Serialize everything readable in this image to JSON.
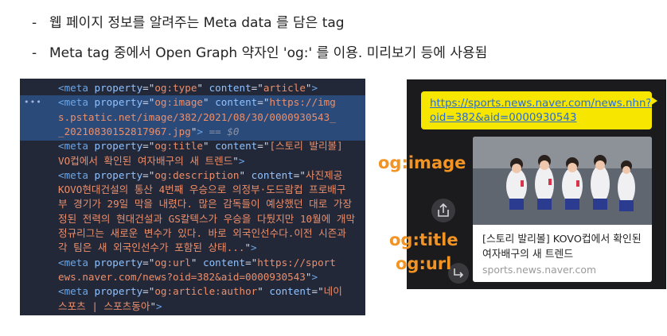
{
  "bullets": [
    {
      "dash": "-",
      "text": "웹 페이지 정보를 알려주는 Meta data 를 담은 tag"
    },
    {
      "dash": "-",
      "text": "Meta tag 중에서 Open Graph 약자인 'og:' 를 이용. 미리보기 등에 사용됨"
    }
  ],
  "code": {
    "gutter_marker": "•••",
    "lines": [
      [
        {
          "c": "tag",
          "t": "<meta "
        },
        {
          "c": "attr",
          "t": "property"
        },
        {
          "c": "eq",
          "t": "=\""
        },
        {
          "c": "str",
          "t": "og:type"
        },
        {
          "c": "eq",
          "t": "\" "
        },
        {
          "c": "attr",
          "t": "content"
        },
        {
          "c": "eq",
          "t": "=\""
        },
        {
          "c": "str",
          "t": "article"
        },
        {
          "c": "eq",
          "t": "\""
        },
        {
          "c": "tag",
          "t": ">"
        }
      ],
      [
        {
          "c": "tag",
          "t": "<meta "
        },
        {
          "c": "attr",
          "t": "property"
        },
        {
          "c": "eq",
          "t": "=\""
        },
        {
          "c": "str",
          "t": "og:image"
        },
        {
          "c": "eq",
          "t": "\" "
        },
        {
          "c": "attr",
          "t": "content"
        },
        {
          "c": "eq",
          "t": "=\""
        },
        {
          "c": "str",
          "t": "https://img"
        }
      ],
      [
        {
          "c": "str",
          "t": "s.pstatic.net/image/382/2021/08/30/0000930543_"
        }
      ],
      [
        {
          "c": "str",
          "t": "_20210830152817967.jpg"
        },
        {
          "c": "eq",
          "t": "\""
        },
        {
          "c": "tag",
          "t": ">"
        },
        {
          "c": "dim",
          "t": " == $0"
        }
      ],
      [
        {
          "c": "tag",
          "t": "<meta "
        },
        {
          "c": "attr",
          "t": "property"
        },
        {
          "c": "eq",
          "t": "=\""
        },
        {
          "c": "str",
          "t": "og:title"
        },
        {
          "c": "eq",
          "t": "\" "
        },
        {
          "c": "attr",
          "t": "content"
        },
        {
          "c": "eq",
          "t": "=\""
        },
        {
          "c": "str",
          "t": "[스토리 발리볼]"
        }
      ],
      [
        {
          "c": "str",
          "t": "VO컵에서 확인된 여자배구의 새 트렌드"
        },
        {
          "c": "eq",
          "t": "\""
        },
        {
          "c": "tag",
          "t": ">"
        }
      ],
      [
        {
          "c": "tag",
          "t": "<meta "
        },
        {
          "c": "attr",
          "t": "property"
        },
        {
          "c": "eq",
          "t": "=\""
        },
        {
          "c": "str",
          "t": "og:description"
        },
        {
          "c": "eq",
          "t": "\" "
        },
        {
          "c": "attr",
          "t": "content"
        },
        {
          "c": "eq",
          "t": "=\""
        },
        {
          "c": "str",
          "t": "사진제공"
        }
      ],
      [
        {
          "c": "str",
          "t": "KOVO현대건설의 통산 4번째 우승으로 의정부·도드람컵 프로배구"
        }
      ],
      [
        {
          "c": "str",
          "t": "부 경기가 29일 막을 내렸다. 많은 감독들이 예상했던 대로 가장"
        }
      ],
      [
        {
          "c": "str",
          "t": "정된 전력의 현대건설과 GS칼텍스가 우승을 다퉜지만 10월에 개막"
        }
      ],
      [
        {
          "c": "str",
          "t": "정규리그는 새로운 변수가 있다. 바로 외국인선수다.이전 시즌과"
        }
      ],
      [
        {
          "c": "str",
          "t": "각 팀은 새 외국인선수가 포함된 상태..."
        },
        {
          "c": "eq",
          "t": "\""
        },
        {
          "c": "tag",
          "t": ">"
        }
      ],
      [
        {
          "c": "tag",
          "t": "<meta "
        },
        {
          "c": "attr",
          "t": "property"
        },
        {
          "c": "eq",
          "t": "=\""
        },
        {
          "c": "str",
          "t": "og:url"
        },
        {
          "c": "eq",
          "t": "\" "
        },
        {
          "c": "attr",
          "t": "content"
        },
        {
          "c": "eq",
          "t": "=\""
        },
        {
          "c": "str",
          "t": "https://sport"
        }
      ],
      [
        {
          "c": "str",
          "t": "ews.naver.com/news?oid=382&aid=0000930543"
        },
        {
          "c": "eq",
          "t": "\""
        },
        {
          "c": "tag",
          "t": ">"
        }
      ],
      [
        {
          "c": "tag",
          "t": "<meta "
        },
        {
          "c": "attr",
          "t": "property"
        },
        {
          "c": "eq",
          "t": "=\""
        },
        {
          "c": "str",
          "t": "og:article:author"
        },
        {
          "c": "eq",
          "t": "\" "
        },
        {
          "c": "attr",
          "t": "content"
        },
        {
          "c": "eq",
          "t": "=\""
        },
        {
          "c": "str",
          "t": "네이"
        }
      ],
      [
        {
          "c": "str",
          "t": "스포츠 | 스포츠동아"
        },
        {
          "c": "eq",
          "t": "\""
        },
        {
          "c": "tag",
          "t": ">"
        }
      ]
    ]
  },
  "chat": {
    "link_line1": "https://sports.news.naver.com/news.nhn?",
    "link_line2": "oid=382&aid=0000930543",
    "card_title": "[스토리 발리볼] KOVO컵에서 확인된 여자배구의 새 트렌드",
    "card_domain": "sports.news.naver.com",
    "share_icon": "share-icon",
    "forward_icon": "forward-icon"
  },
  "labels": {
    "og_image": "og:image",
    "og_title": "og:title",
    "og_url": "og:url"
  },
  "colors": {
    "accent_orange": "#f39321",
    "bubble_yellow": "#f7e600",
    "code_bg": "#232838",
    "code_highlight": "#2a4b7a"
  }
}
